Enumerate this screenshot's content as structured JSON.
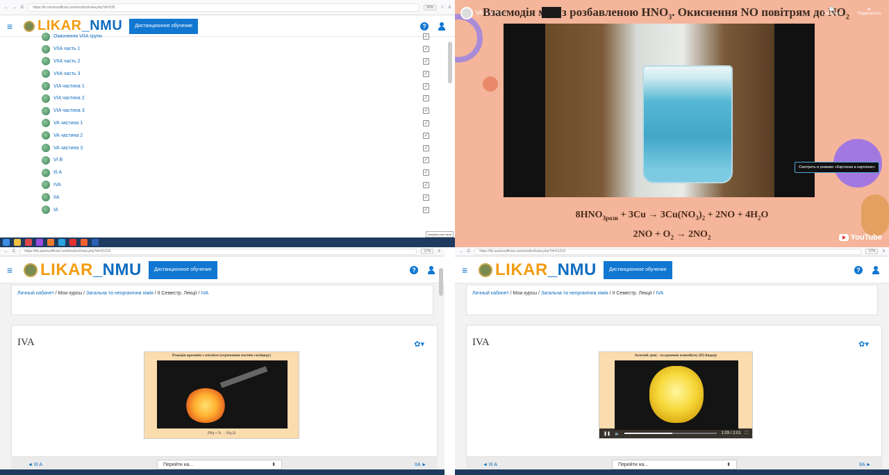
{
  "browser": {
    "url_q1": "https://lk.ssrnmuofficial.com/mod/url/view.php?id=535",
    "url_q3": "https://lik.uanmuofficial.com/mod/url/view.php?id=51219",
    "url_q4": "https://lik.uanmuofficial.com/mod/url/view.php?id=51219",
    "zoom_q1": "90%",
    "zoom_q3": "17%",
    "zoom_q4": "17%"
  },
  "site": {
    "logo": "LIKAR_NMU",
    "logo_part_a": "LIKAR",
    "logo_part_b": "_NMU",
    "distance_button": "Дистанционное обучение"
  },
  "list": {
    "items": [
      {
        "label": "Окиснення VIIА групи"
      },
      {
        "label": "VIIA часть 1"
      },
      {
        "label": "VIIA часть 2"
      },
      {
        "label": "VIIA часть 3"
      },
      {
        "label": "VIA частина 1"
      },
      {
        "label": "VIA частина 2"
      },
      {
        "label": "VIA частина 3"
      },
      {
        "label": "VA частина 1"
      },
      {
        "label": "VA частина 2"
      },
      {
        "label": "VA частина 3"
      },
      {
        "label": "VI B"
      },
      {
        "label": "III A"
      },
      {
        "label": "IVA"
      },
      {
        "label": "IIA"
      },
      {
        "label": "IA"
      }
    ],
    "tooltip": "Свернуть все окна"
  },
  "video": {
    "channel": "VA частина 3",
    "title_a": "Взаємодія міді з розбавленою HNO",
    "title_b": ". Окиснення NO повітрям до NO",
    "sub3": "3",
    "sub2": "2",
    "share": "Поделиться",
    "watch_later": "Смотреть",
    "pip": "Смотреть в режиме «Картинка в картинке»",
    "eq1_a": "8HNO",
    "eq1_sub": "3розв",
    "eq1_b": " + 3Cu → 3Cu(NO",
    "eq1_sub2": "3",
    "eq1_c": ")",
    "eq1_sub3": "2",
    "eq1_d": " + 2NO + 4H",
    "eq1_sub4": "2",
    "eq1_e": "O",
    "eq2_a": "2NO + O",
    "eq2_sub": "2",
    "eq2_b": " → 2NO",
    "eq2_sub2": "2",
    "youtube": "YouTube"
  },
  "course": {
    "crumb_home": "Личный кабинет",
    "crumb_courses": "Мои курсы",
    "crumb_subject": "Загальна та неорганічна хімія",
    "crumb_semester": "II Семестр. Лекції",
    "crumb_page": "IVA",
    "sep": "/",
    "heading": "IVA",
    "frame3_caption": "Реакція кремнію з магнієм (отримання магнію силіциду)",
    "frame3_formula": "2Mg + Si → Mg₂Si",
    "frame4_caption": "Золотий дощ – осадження плюмбуму (II) йодиду",
    "frame4_time": "1:03 / 2:01",
    "frame4_progress": 0.52,
    "prev": "◄ III A",
    "next": "IIA ►",
    "jump": "Перейти на..."
  },
  "colors": {
    "accent": "#1177d1",
    "logo_orange": "#f39c12"
  }
}
